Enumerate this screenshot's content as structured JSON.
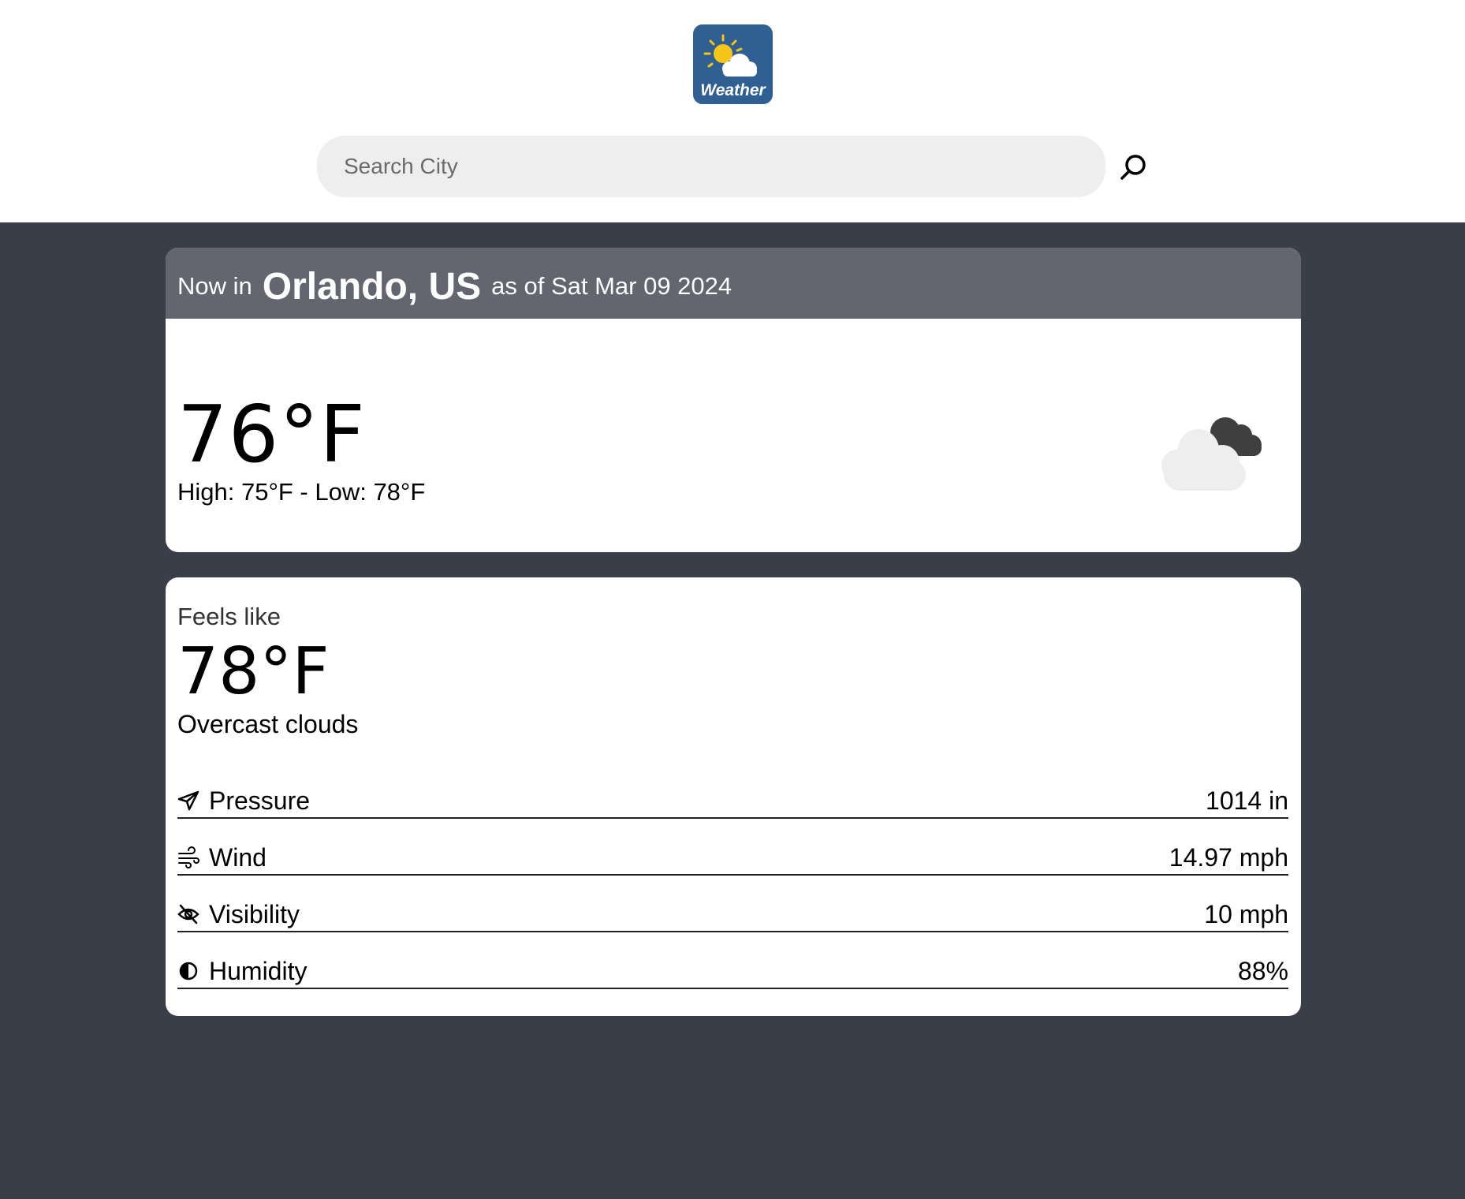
{
  "app": {
    "logo_text": "Weather"
  },
  "search": {
    "placeholder": "Search City",
    "value": ""
  },
  "current": {
    "prefix": "Now in",
    "city": "Orlando, US",
    "as_of": "as of Sat Mar 09 2024",
    "temperature": "76°F",
    "high_low": "High: 75°F - Low: 78°F",
    "icon": "overcast-clouds-icon"
  },
  "details": {
    "feels_like_label": "Feels like",
    "feels_like": "78°F",
    "description": "Overcast clouds",
    "stats": [
      {
        "icon": "paper-plane-icon",
        "label": "Pressure",
        "value": "1014 in"
      },
      {
        "icon": "wind-icon",
        "label": "Wind",
        "value": "14.97 mph"
      },
      {
        "icon": "eye-slash-icon",
        "label": "Visibility",
        "value": "10 mph"
      },
      {
        "icon": "half-circle-icon",
        "label": "Humidity",
        "value": "88%"
      }
    ]
  },
  "colors": {
    "page_bg": "#3a3e48",
    "header_bg": "#63666f",
    "logo_bg": "#2f5f93",
    "sun": "#f5c518"
  }
}
